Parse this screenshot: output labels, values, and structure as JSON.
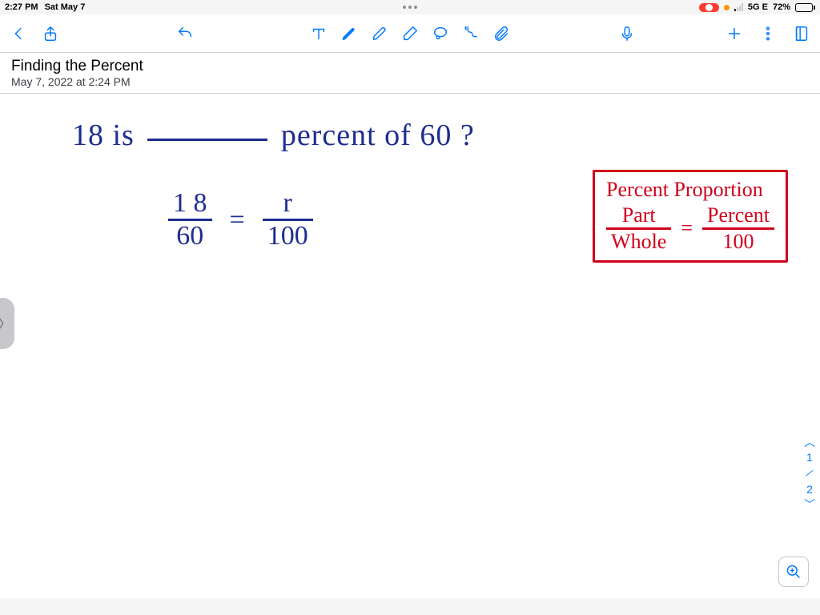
{
  "status": {
    "time": "2:27 PM",
    "date": "Sat May 7",
    "network": "5G E",
    "battery_pct": "72%"
  },
  "note": {
    "title": "Finding the Percent",
    "subtitle": "May 7, 2022 at 2:24 PM"
  },
  "handwriting": {
    "question_pre": "18  is",
    "question_post": "percent  of  60 ?",
    "frac1_num": "1 8",
    "frac1_den": "60",
    "equals": "=",
    "frac2_num": "r",
    "frac2_den": "100",
    "box_title": "Percent Proportion",
    "box_f1_num": "Part",
    "box_f1_den": "Whole",
    "box_f2_num": "Percent",
    "box_f2_den": "100"
  },
  "pager": {
    "current": "1",
    "total": "2"
  }
}
